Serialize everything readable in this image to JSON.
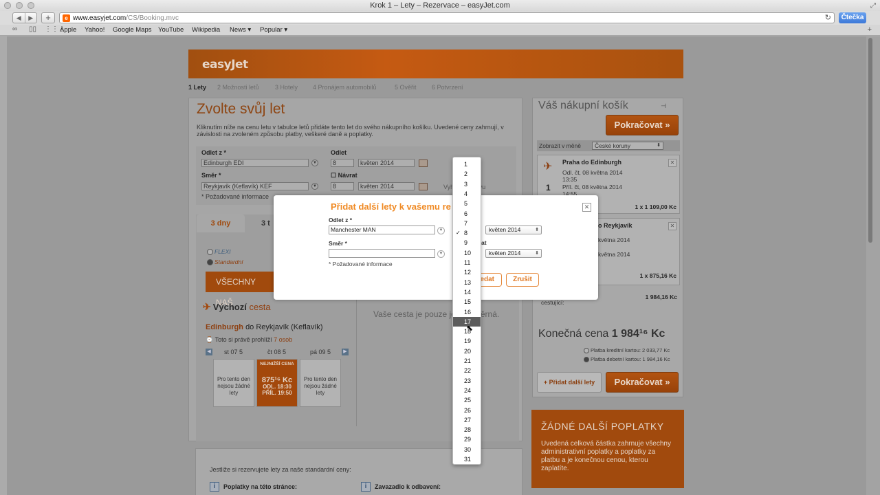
{
  "window": {
    "title": "Krok 1 – Lety – Rezervace – easyJet.com"
  },
  "browser": {
    "url_host": "www.easyjet.com",
    "url_path": "/CS/Booking.mvc",
    "reader": "Čtečka",
    "bookmarks": [
      "Apple",
      "Yahoo!",
      "Google Maps",
      "YouTube",
      "Wikipedia",
      "News ▾",
      "Popular ▾"
    ]
  },
  "site": {
    "logo": "easyJet",
    "steps": [
      "1 Lety",
      "2 Možnosti letů",
      "3 Hotely",
      "4 Pronájem automobilů",
      "5 Ověřit",
      "6 Potvrzení"
    ],
    "title": "Zvolte svůj let",
    "intro": "Kliknutím níže na cenu letu v tabulce letů přidáte tento let do svého nákupního košíku. Uvedené ceny zahrnují, v závislosti na zvoleném způsobu platby, veškeré daně a poplatky.",
    "form": {
      "from_label": "Odlet z *",
      "from_value": "Edinburgh EDI",
      "to_label": "Směr *",
      "to_value": "Reykjavík (Keflavík) KEF",
      "depart_label": "Odlet",
      "depart_day": "8",
      "depart_month": "květen 2014",
      "return_label": "Návrat",
      "return_day": "8",
      "return_month": "květen 2014",
      "required": "* Požadované informace",
      "search_btn": "Vyhledat znovu"
    },
    "tabs": [
      "3 dny",
      "3 t"
    ],
    "fare_flexi": "FLEXI",
    "fare_standard": "Standardní",
    "all_btn": "VŠECHNY NAŠ",
    "outbound_bold": "Výchozí",
    "outbound_light": "cesta",
    "route_from": "Edinburgh",
    "route_to": "do Reykjavík (Keflavík)",
    "viewers_pre": "Toto si právě prohlíží",
    "viewers_count": "7 osob",
    "days": [
      "st 07 5",
      "čt 08 5",
      "pá 09 5"
    ],
    "no_flights": "Pro tento den nejsou žádné lety",
    "cheapest_tag": "NEJNIŽŠÍ CENA",
    "cheapest_price": "875¹⁶ Kc",
    "cheapest_dep": "ODL. 18:30",
    "cheapest_arr": "PŘÍL. 19:50",
    "return_msg": "Vaše cesta je pouze jednosměrná.",
    "info_text": "Jestliže si rezervujete lety za naše standardní ceny:",
    "info_h1": "Poplatky na této stránce:",
    "info_h2": "Zavazadlo k odbavení:"
  },
  "basket": {
    "title": "Váš nákupní košík",
    "continue": "Pokračovat »",
    "currency_label": "Zobrazit v měně",
    "currency_value": "České koruny",
    "flight1": {
      "title": "Praha do Edinburgh",
      "dep": "Odl. čt, 08 května 2014",
      "dep_time": "13:35",
      "arr": "Příl. čt, 08 května 2014",
      "arr_time": "14:55",
      "qty": "1",
      "price": "1 x 1 109,00 Kc"
    },
    "flight2": {
      "title": "o Reykjavík",
      "dep": "května 2014",
      "arr": "května 2014",
      "price": "1 x 875,16 Kc"
    },
    "options_text": "možnosti pro všechny cestující:",
    "options_price": "1 984,16 Kc",
    "final_label": "Konečná cena",
    "final_value": "1 984¹⁶ Kc",
    "pay_credit": "Platba kreditní kartou: 2 033,77 Kc",
    "pay_debit": "Platba debetní kartou: 1 984,16 Kc",
    "add_more": "+ Přidat další lety"
  },
  "promo": {
    "heading": "ŽÁDNÉ DALŠÍ POPLATKY",
    "text": "Uvedená celková částka zahrnuje všechny administrativní poplatky a poplatky za platbu a je konečnou cenou, kterou zaplatíte."
  },
  "modal": {
    "title": "Přidat další lety k vašemu re",
    "from_label": "Odlet z *",
    "from_value": "Manchester MAN",
    "to_label": "Směr *",
    "to_value": "",
    "month1": "květen 2014",
    "month2": "květen 2014",
    "return_partial": "at",
    "required": "* Požadované informace",
    "search_btn": "edat",
    "cancel_btn": "Zrušit"
  },
  "daylist": {
    "options": [
      "1",
      "2",
      "3",
      "4",
      "5",
      "6",
      "7",
      "8",
      "9",
      "10",
      "11",
      "12",
      "13",
      "14",
      "15",
      "16",
      "17",
      "18",
      "19",
      "20",
      "21",
      "22",
      "23",
      "24",
      "25",
      "26",
      "27",
      "28",
      "29",
      "30",
      "31"
    ],
    "selected": "8",
    "hovered": "17"
  },
  "colors": {
    "brand": "#ff6600",
    "modal_accent": "#f08a24"
  }
}
